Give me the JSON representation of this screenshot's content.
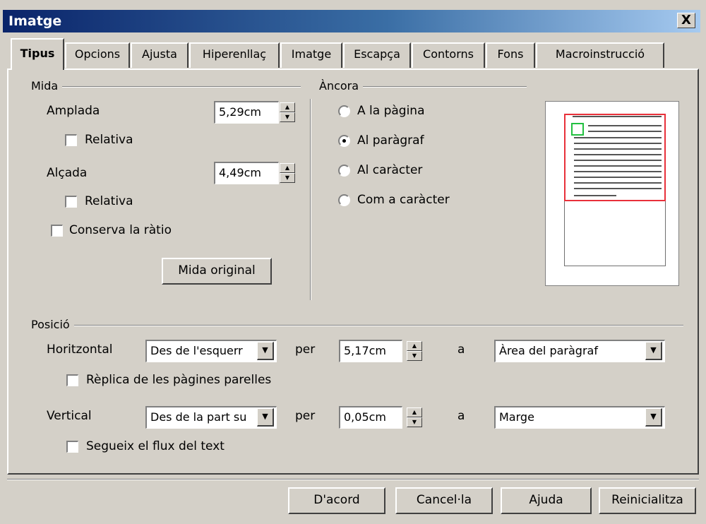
{
  "window": {
    "title": "Imatge",
    "close_glyph": "X"
  },
  "tabs": [
    {
      "label": "Tipus",
      "active": true
    },
    {
      "label": "Opcions"
    },
    {
      "label": "Ajusta"
    },
    {
      "label": "Hiperenllaç"
    },
    {
      "label": "Imatge"
    },
    {
      "label": "Escapça"
    },
    {
      "label": "Contorns"
    },
    {
      "label": "Fons"
    },
    {
      "label": "Macroinstrucció"
    }
  ],
  "mida": {
    "group_label": "Mida",
    "width_label": "Amplada",
    "width_value": "5,29cm",
    "width_relative": "Relativa",
    "height_label": "Alçada",
    "height_value": "4,49cm",
    "height_relative": "Relativa",
    "keep_ratio": "Conserva la ràtio",
    "original_size_button": "Mida original"
  },
  "ancora": {
    "group_label": "Àncora",
    "options": [
      "A la pàgina",
      "Al paràgraf",
      "Al caràcter",
      "Com a caràcter"
    ],
    "selected": "Al paràgraf"
  },
  "posicio": {
    "group_label": "Posició",
    "horizontal_label": "Horitzontal",
    "horizontal_value": "Des de l'esquerr",
    "horizontal_per": "per",
    "horizontal_offset": "5,17cm",
    "horizontal_a": "a",
    "horizontal_to": "Àrea del paràgraf",
    "mirror": "Rèplica de les pàgines parelles",
    "vertical_label": "Vertical",
    "vertical_value": "Des de la part su",
    "vertical_per": "per",
    "vertical_offset": "0,05cm",
    "vertical_a": "a",
    "vertical_to": "Marge",
    "follow_flow": "Segueix el flux del text"
  },
  "buttons": {
    "ok": "D'acord",
    "cancel": "Cancel·la",
    "help": "Ajuda",
    "reset": "Reinicialitza"
  },
  "colors": {
    "titlebar": "#0a246a",
    "face": "#d4d0c8",
    "preview_frame": "#e8303a",
    "preview_image": "#22c040"
  }
}
